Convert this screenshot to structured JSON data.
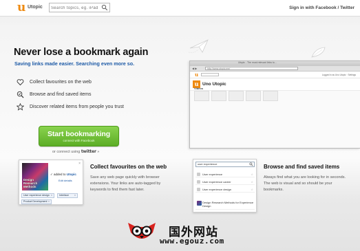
{
  "header": {
    "logo_letter": "u",
    "logo_text": "Utopic",
    "search_placeholder": "Search topics, eg. iPad",
    "signin_prefix": "Sign in with",
    "facebook_label": "Facebook",
    "separator": "/",
    "twitter_label": "Twitter"
  },
  "hero": {
    "title": "Never lose a bookmark again",
    "subtitle": "Saving links made easier. Searching even more so.",
    "features": [
      {
        "icon": "heart-icon",
        "label": "Collect favourites on the web"
      },
      {
        "icon": "magnifier-check-icon",
        "label": "Browse and find saved items"
      },
      {
        "icon": "star-icon",
        "label": "Discover related items from people you trust"
      }
    ]
  },
  "cta": {
    "label": "Start bookmarking",
    "sublabel": "connect with Facebook",
    "alt_prefix": "or connect using",
    "alt_service": "twitter",
    "alt_suffix": "»"
  },
  "browser_mock": {
    "window_title": "Utopic - The most relevant links to...",
    "url": "http://www.utopic.me/",
    "header_right": "Logged in as Uno Utopic · Settings",
    "profile_name": "Uno Utopic",
    "section": "Videos"
  },
  "collect": {
    "card": {
      "thumb_title": "Design Research Methods",
      "added_check": "✓",
      "added_text": "added to",
      "added_brand": "Utopic",
      "edit_link": "Edit details",
      "close": "×",
      "tags": [
        "User experience design",
        "Interface",
        "Product Development"
      ]
    },
    "title": "Collect favourites on the web",
    "body": "Save any web page quickly with browser extensions. Your links are auto-tagged by keywords to find them fast later."
  },
  "browse": {
    "card": {
      "query": "user experience",
      "results": [
        "User experience",
        "User experience career",
        "User experience design"
      ],
      "big_result": "Design Research Methods for Experience Design"
    },
    "title": "Browse and find saved items",
    "body": "Always find what you are looking for in seconds. The web is visual and so should be your bookmarks."
  },
  "watermark": {
    "chinese": "国外网站",
    "url": "www.egouz.com"
  },
  "colors": {
    "brand_orange": "#ee8a11",
    "cta_green": "#6ec236",
    "subtitle_blue": "#1d5aa6"
  }
}
